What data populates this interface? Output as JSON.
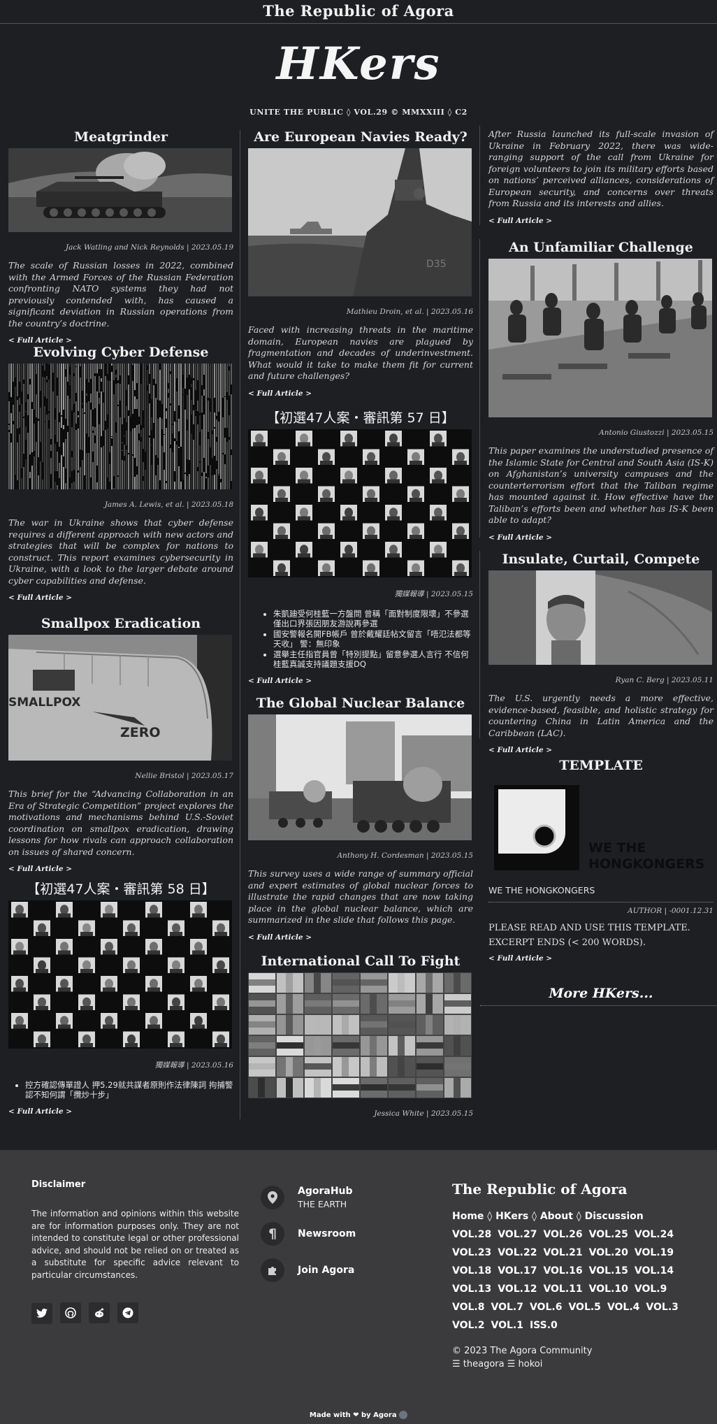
{
  "site": {
    "brand": "The Republic of Agora",
    "logo": "HKers",
    "subline": "UNITE THE PUBLIC ◊ VOL.29 © MMXXIII ◊ C2"
  },
  "articles": {
    "meatgrinder": {
      "title": "Meatgrinder",
      "byline": "Jack Watling and Nick Reynolds | 2023.05.19",
      "summary": "The scale of Russian losses in 2022, combined with the Armed Forces of the Russian Federation confronting NATO systems they had not previously contended with, has caused a significant deviation in Russian operations from the country’s doctrine.",
      "more": "< Full Article >"
    },
    "cyber": {
      "title": "Evolving Cyber Defense",
      "byline": "James A. Lewis, et al. | 2023.05.18",
      "summary": "The war in Ukraine shows that cyber defense requires a different approach with new actors and strategies that will be complex for nations to construct. This report examines cybersecurity in Ukraine, with a look to the larger debate around cyber capabilities and defense.",
      "more": "< Full Article >"
    },
    "smallpox": {
      "title": "Smallpox Eradication",
      "byline": "Nellie Bristol | 2023.05.17",
      "summary": "This brief for the “Advancing Collaboration in an Era of Strategic Competition” project explores the motivations and mechanisms behind U.S.-Soviet coordination on smallpox eradication, drawing lessons for how rivals can approach collaboration on issues of shared concern.",
      "more": "< Full Article >",
      "img_text_1": "SMALLPOX",
      "img_text_2": "ZERO"
    },
    "trial58": {
      "title": "【初選47人案・審訊第 58 日】",
      "byline": "獨媒報導 | 2023.05.16",
      "bullets": [
        "控方確認傳單證人 押5.29就共謀者原則作法律陳詞 拘捕警認不知何謂「攬炒十步」"
      ],
      "more": "< Full Article >"
    },
    "navies": {
      "title": "Are European Navies Ready?",
      "byline": "Mathieu Droin, et al. | 2023.05.16",
      "summary": "Faced with increasing threats in the maritime domain, European navies are plagued by fragmentation and decades of underinvestment. What would it take to make them fit for current and future challenges?",
      "more": "< Full Article >",
      "hull_number": "D35"
    },
    "trial57": {
      "title": "【初選47人案・審訊第 57 日】",
      "byline": "獨媒報導 | 2023.05.15",
      "bullets": [
        "朱凱廸受何桂藍一方盤問 曾稱「面對制度限壞」不參選僅出口界張因朋友游說再參選",
        "國安警報名開FB帳戶 曾於戴耀廷帖文留言「唔氾法都等天收」 警：無印象",
        "選舉主任指官員曾「特別提點」留意參選人言行 不信何桂藍真誠支持議題支援DQ"
      ],
      "more": "< Full Article >"
    },
    "nuclear": {
      "title": "The Global Nuclear Balance",
      "byline": "Anthony H. Cordesman | 2023.05.15",
      "summary": "This survey uses a wide range of summary official and expert estimates of global nuclear forces to illustrate the rapid changes that are now taking place in the global nuclear balance, which are summarized in the slide that follows this page.",
      "more": "< Full Article >"
    },
    "call": {
      "title": "International Call To Fight",
      "byline": "Jessica White | 2023.05.15"
    },
    "call_cont": {
      "summary": "After Russia launched its full-scale invasion of Ukraine in February 2022, there was wide-ranging support of the call from Ukraine for foreign volunteers to join its military efforts based on nations’ perceived alliances, considerations of European security, and concerns over threats from Russia and its interests and allies.",
      "more": "< Full Article >"
    },
    "unfamiliar": {
      "title": "An Unfamiliar Challenge",
      "byline": "Antonio Giustozzi | 2023.05.15",
      "summary": "This paper examines the understudied presence of the Islamic State for Central and South Asia (IS-K) on Afghanistan’s university campuses and the counterterrorism effort that the Taliban regime has mounted against it. How effective have the Taliban’s efforts been and whether has IS-K been able to adapt?",
      "more": "< Full Article >"
    },
    "insulate": {
      "title": "Insulate, Curtail, Compete",
      "byline": "Ryan C. Berg | 2023.05.11",
      "summary": "The U.S. urgently needs a more effective, evidence-based, feasible, and holistic strategy for countering China in Latin America and the Caribbean (LAC).",
      "more": "< Full Article >"
    },
    "template": {
      "title": "TEMPLATE",
      "img_text_1": "WE THE",
      "img_text_2": "HONGKONGERS",
      "caption": "WE THE HONGKONGERS",
      "byline": "AUTHOR | -0001.12.31",
      "line1": "PLEASE READ AND USE THIS TEMPLATE.",
      "line2": "EXCERPT ENDS (< 200 WORDS).",
      "more": "< Full Article >"
    }
  },
  "more_hkers": "More HKers...",
  "footer": {
    "disclaimer_title": "Disclaimer",
    "disclaimer_text": "The information and opinions within this website are for information purposes only. They are not intended to constitute legal or other professional advice, and should not be relied on or treated as a substitute for specific advice relevant to particular circumstances.",
    "social_icons": [
      "twitter-icon",
      "github-icon",
      "reddit-icon",
      "telegram-icon"
    ],
    "hubs": [
      {
        "name": "AgoraHub",
        "sub": "THE EARTH",
        "icon": "map-pin-icon"
      },
      {
        "name": "Newsroom",
        "sub": "",
        "icon": "pilcrow-icon"
      },
      {
        "name": "Join Agora",
        "sub": "",
        "icon": "puzzle-icon"
      }
    ],
    "brand": "The Republic of Agora",
    "nav": [
      "Home",
      "HKers",
      "About",
      "Discussion"
    ],
    "nav_sep": "◊",
    "vols": [
      [
        "VOL.28",
        "VOL.27",
        "VOL.26",
        "VOL.25",
        "VOL.24"
      ],
      [
        "VOL.23",
        "VOL.22",
        "VOL.21",
        "VOL.20",
        "VOL.19"
      ],
      [
        "VOL.18",
        "VOL.17",
        "VOL.16",
        "VOL.15",
        "VOL.14"
      ],
      [
        "VOL.13",
        "VOL.12",
        "VOL.11",
        "VOL.10",
        "VOL.9"
      ],
      [
        "VOL.8",
        "VOL.7",
        "VOL.6",
        "VOL.5",
        "VOL.4",
        "VOL.3"
      ],
      [
        "VOL.2",
        "VOL.1",
        "ISS.0"
      ]
    ],
    "copyright": "© 2023 The Agora Community",
    "handles": "☰ theagora ☰ hokoi",
    "made_with_prefix": "Made with",
    "made_with_suffix": "by Agora"
  },
  "colors": {
    "background": "#1e1f23",
    "footer": "#3b3b3d",
    "text": "#dcdcdc"
  }
}
